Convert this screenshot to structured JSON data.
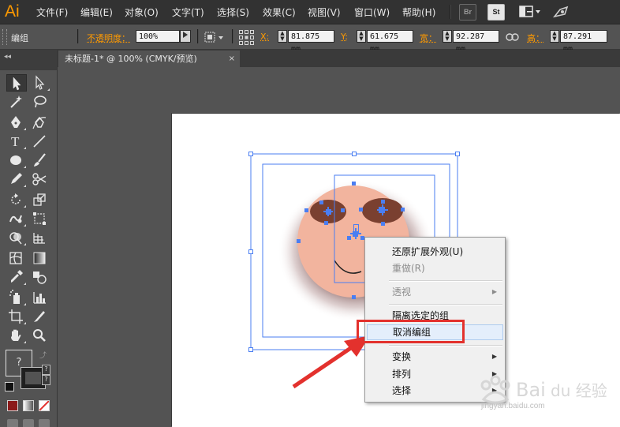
{
  "app": {
    "logo": "Ai"
  },
  "menubar": {
    "items": [
      "文件(F)",
      "编辑(E)",
      "对象(O)",
      "文字(T)",
      "选择(S)",
      "效果(C)",
      "视图(V)",
      "窗口(W)",
      "帮助(H)"
    ],
    "br_label": "Br",
    "st_label": "St"
  },
  "controlbar": {
    "selection_label": "编组",
    "opacity_label": "不透明度：",
    "opacity_value": "100%",
    "x_label": "X:",
    "x_value": "81.875 mm",
    "y_label": "Y:",
    "y_value": "61.675 mm",
    "w_label": "宽：",
    "w_value": "92.287 mm",
    "h_label": "高：",
    "h_value": "87.291 mm",
    "accent": "#ff9a00"
  },
  "document": {
    "tab_title": "未标题-1* @ 100% (CMYK/预览)",
    "tab_close": "×"
  },
  "tools": {
    "panel_grip": "◂◂",
    "fill_unknown": "?",
    "stroke_unknown": "?",
    "fill_small": "?",
    "stroke_small": "?"
  },
  "context_menu": {
    "items": [
      {
        "label": "还原扩展外观(U)",
        "enabled": true,
        "submenu": false
      },
      {
        "label": "重做(R)",
        "enabled": false,
        "submenu": false
      },
      {
        "label": "透视",
        "enabled": false,
        "submenu": true
      },
      {
        "label": "隔离选定的组",
        "enabled": true,
        "submenu": false
      },
      {
        "label": "取消编组",
        "enabled": true,
        "submenu": false,
        "highlighted": true
      },
      {
        "label": "变换",
        "enabled": true,
        "submenu": true
      },
      {
        "label": "排列",
        "enabled": true,
        "submenu": true
      },
      {
        "label": "选择",
        "enabled": true,
        "submenu": true
      }
    ],
    "submenu_arrow": "▶"
  },
  "watermark": {
    "text": "jingyan.baidu.com"
  },
  "colors": {
    "face_fill": "#f2b49e",
    "eye_fill": "#7a4030",
    "selection_blue": "#4a7ef2",
    "annotation_red": "#e3312d"
  }
}
